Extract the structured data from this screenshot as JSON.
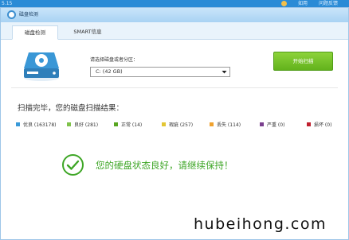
{
  "top_strip": {
    "version": "5.15",
    "right_labels": [
      "如用",
      "问题反馈"
    ]
  },
  "window": {
    "title": "磁盘检测"
  },
  "tabs": [
    {
      "label": "磁盘检测",
      "active": true
    },
    {
      "label": "SMART信息",
      "active": false
    }
  ],
  "select_section": {
    "label": "请选择磁盘或者分区：",
    "selected_value": "C:  (42 GB)",
    "start_button": "开始扫描"
  },
  "result": {
    "title": "扫描完毕，您的磁盘扫描结果：",
    "legend": [
      {
        "label": "优良 (163178)",
        "color": "#3a9ad9"
      },
      {
        "label": "良好 (281)",
        "color": "#7fc24a"
      },
      {
        "label": "正常 (14)",
        "color": "#58a621"
      },
      {
        "label": "瑕疵 (257)",
        "color": "#e3c633"
      },
      {
        "label": "丢失 (114)",
        "color": "#f0a22e"
      },
      {
        "label": "严重 (0)",
        "color": "#7a3f8e"
      },
      {
        "label": "损坏 (0)",
        "color": "#c0202e"
      }
    ],
    "status_message": "您的硬盘状态良好，请继续保持！",
    "status_color": "#3ea626"
  },
  "watermark": "hubeihong.com"
}
